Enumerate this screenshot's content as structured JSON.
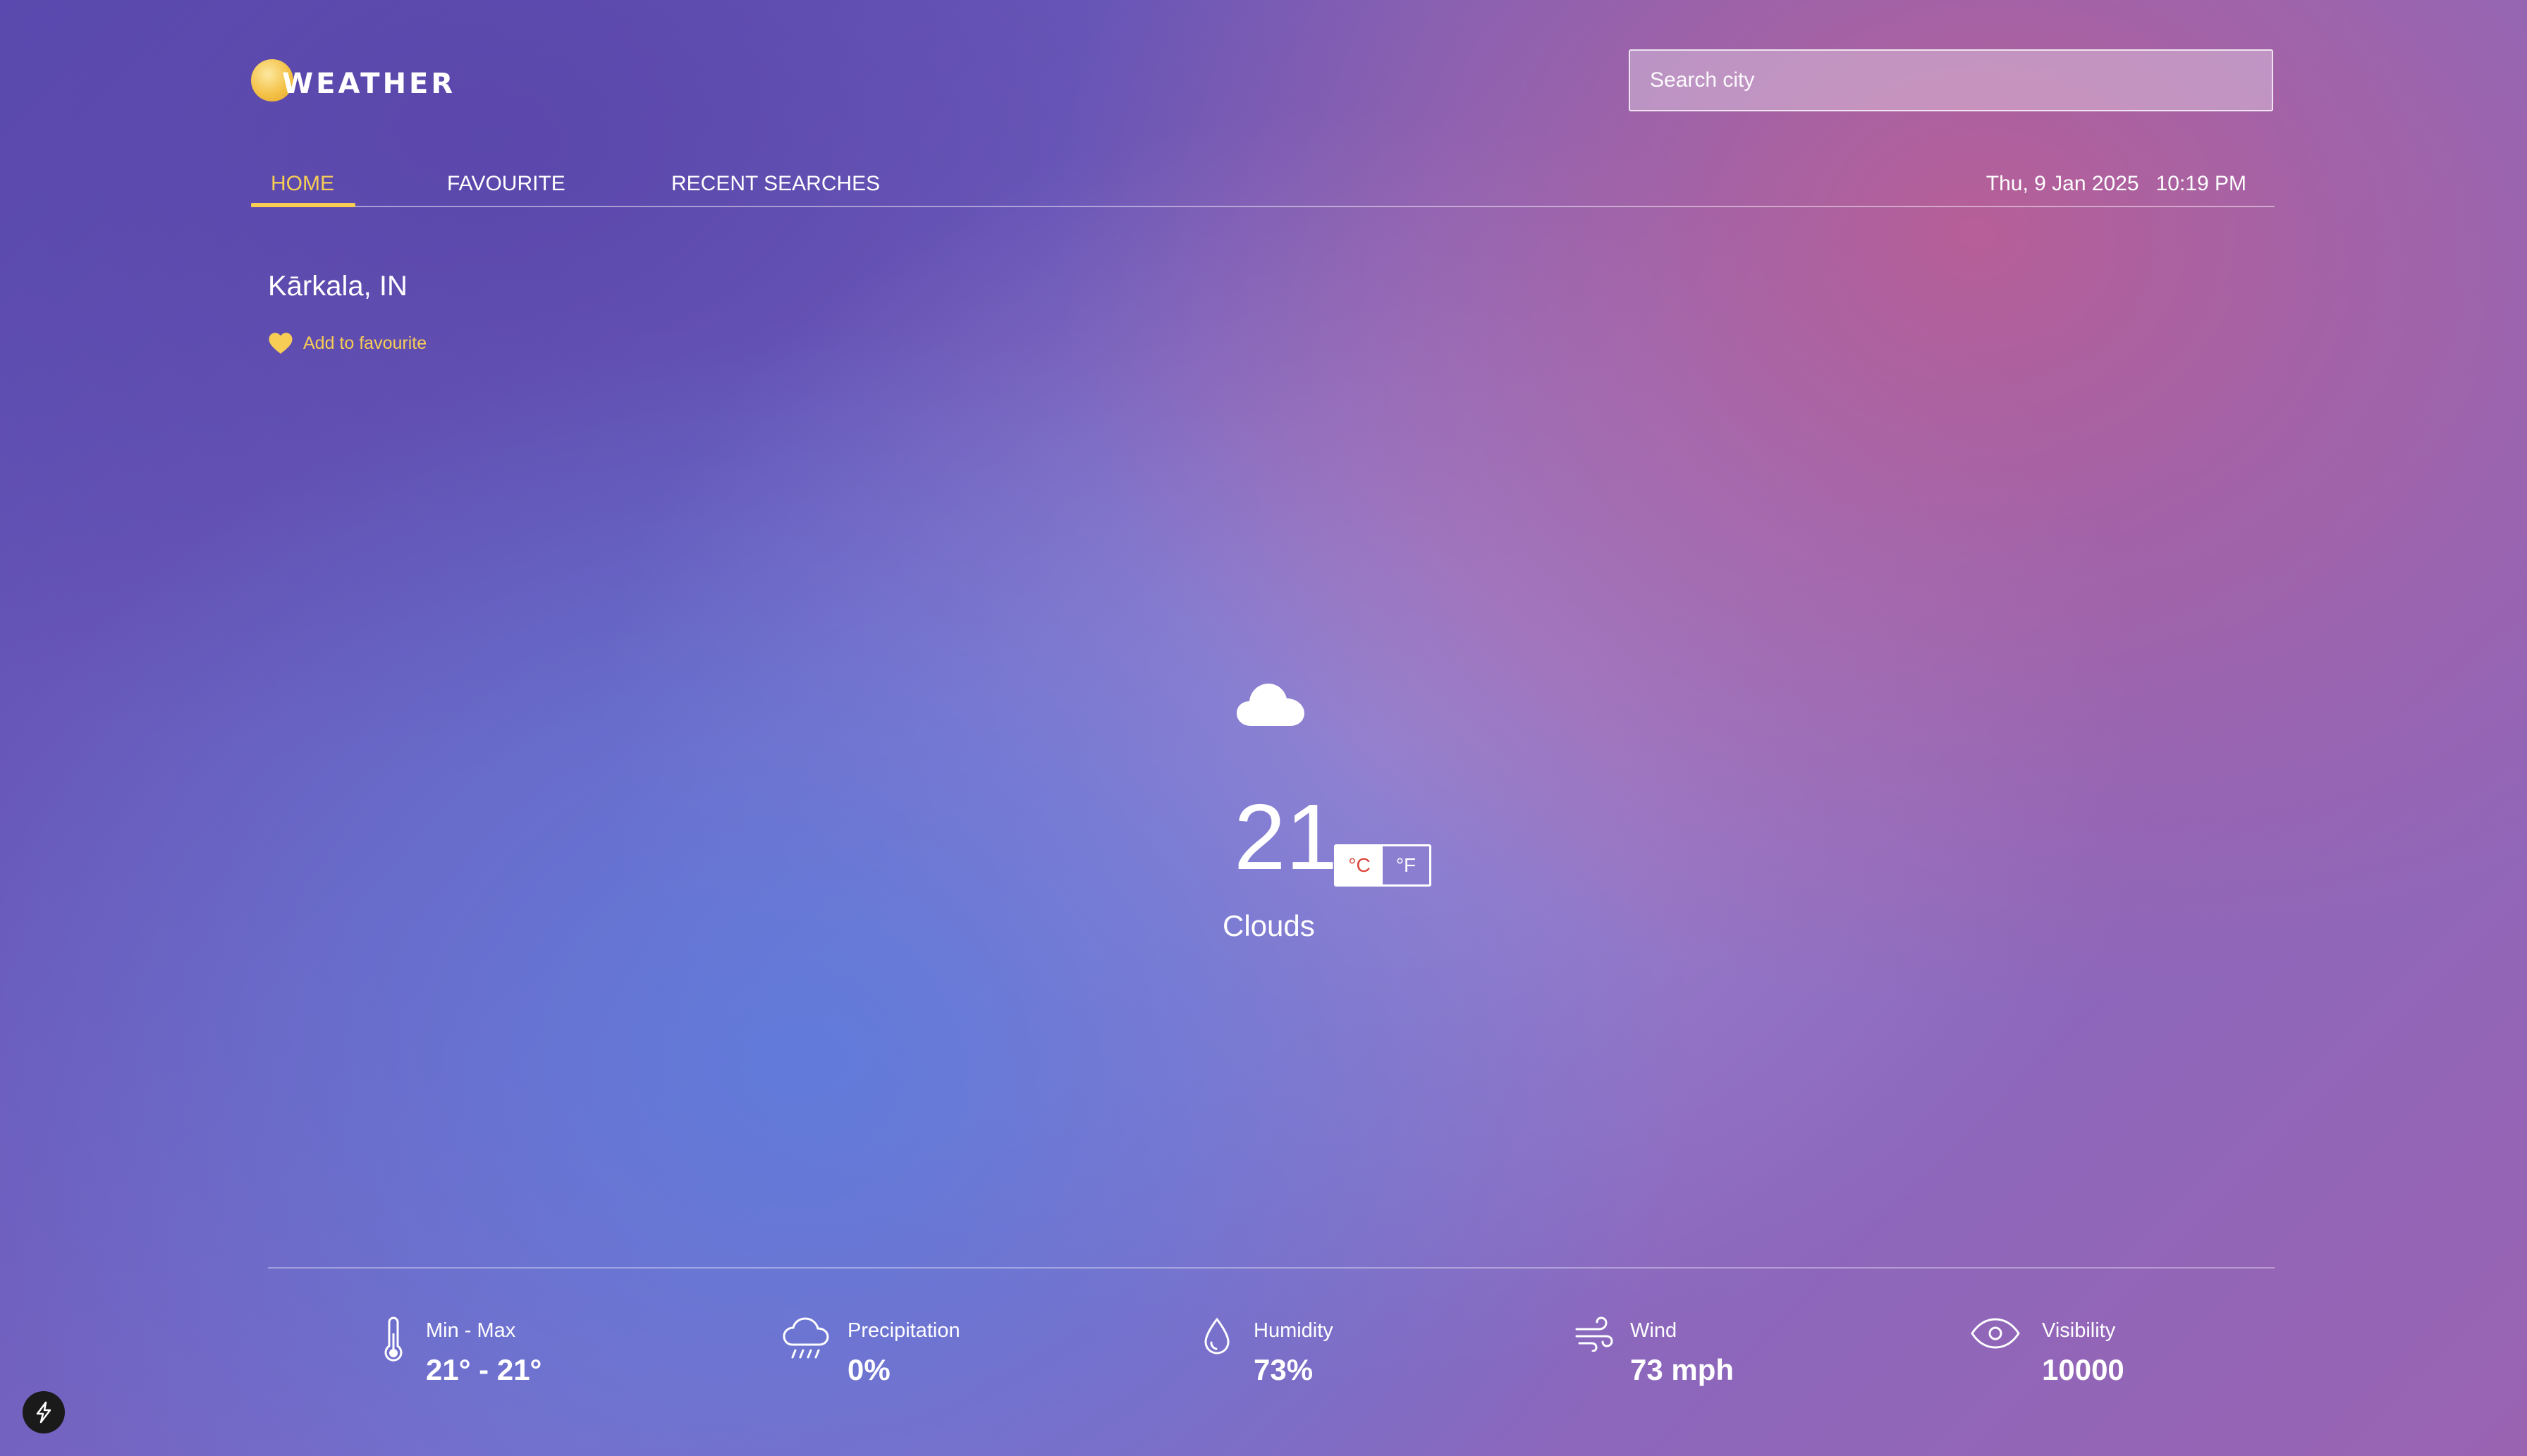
{
  "app": {
    "logo_text": "WEATHER"
  },
  "search": {
    "placeholder": "Search city"
  },
  "nav": {
    "tabs": [
      {
        "label": "HOME",
        "active": true
      },
      {
        "label": "FAVOURITE",
        "active": false
      },
      {
        "label": "RECENT SEARCHES",
        "active": false
      }
    ],
    "date": "Thu, 9 Jan 2025",
    "time": "10:19 PM"
  },
  "location": {
    "name": "Kārkala, IN",
    "favourite_label": "Add to favourite"
  },
  "current": {
    "icon": "cloud-icon",
    "temperature": "21",
    "unit_celsius": "°C",
    "unit_fahrenheit": "°F",
    "selected_unit": "°C",
    "condition": "Clouds"
  },
  "stats": [
    {
      "icon": "thermometer-icon",
      "label": "Min - Max",
      "value": "21° - 21°"
    },
    {
      "icon": "rain-cloud-icon",
      "label": "Precipitation",
      "value": "0%"
    },
    {
      "icon": "droplet-icon",
      "label": "Humidity",
      "value": "73%"
    },
    {
      "icon": "wind-icon",
      "label": "Wind",
      "value": "73 mph"
    },
    {
      "icon": "eye-icon",
      "label": "Visibility",
      "value": "10000"
    }
  ],
  "colors": {
    "accent": "#f7cd56",
    "celsius_active": "#d9473c",
    "background_start": "#5a4bb0",
    "background_end": "#9a63b2"
  }
}
